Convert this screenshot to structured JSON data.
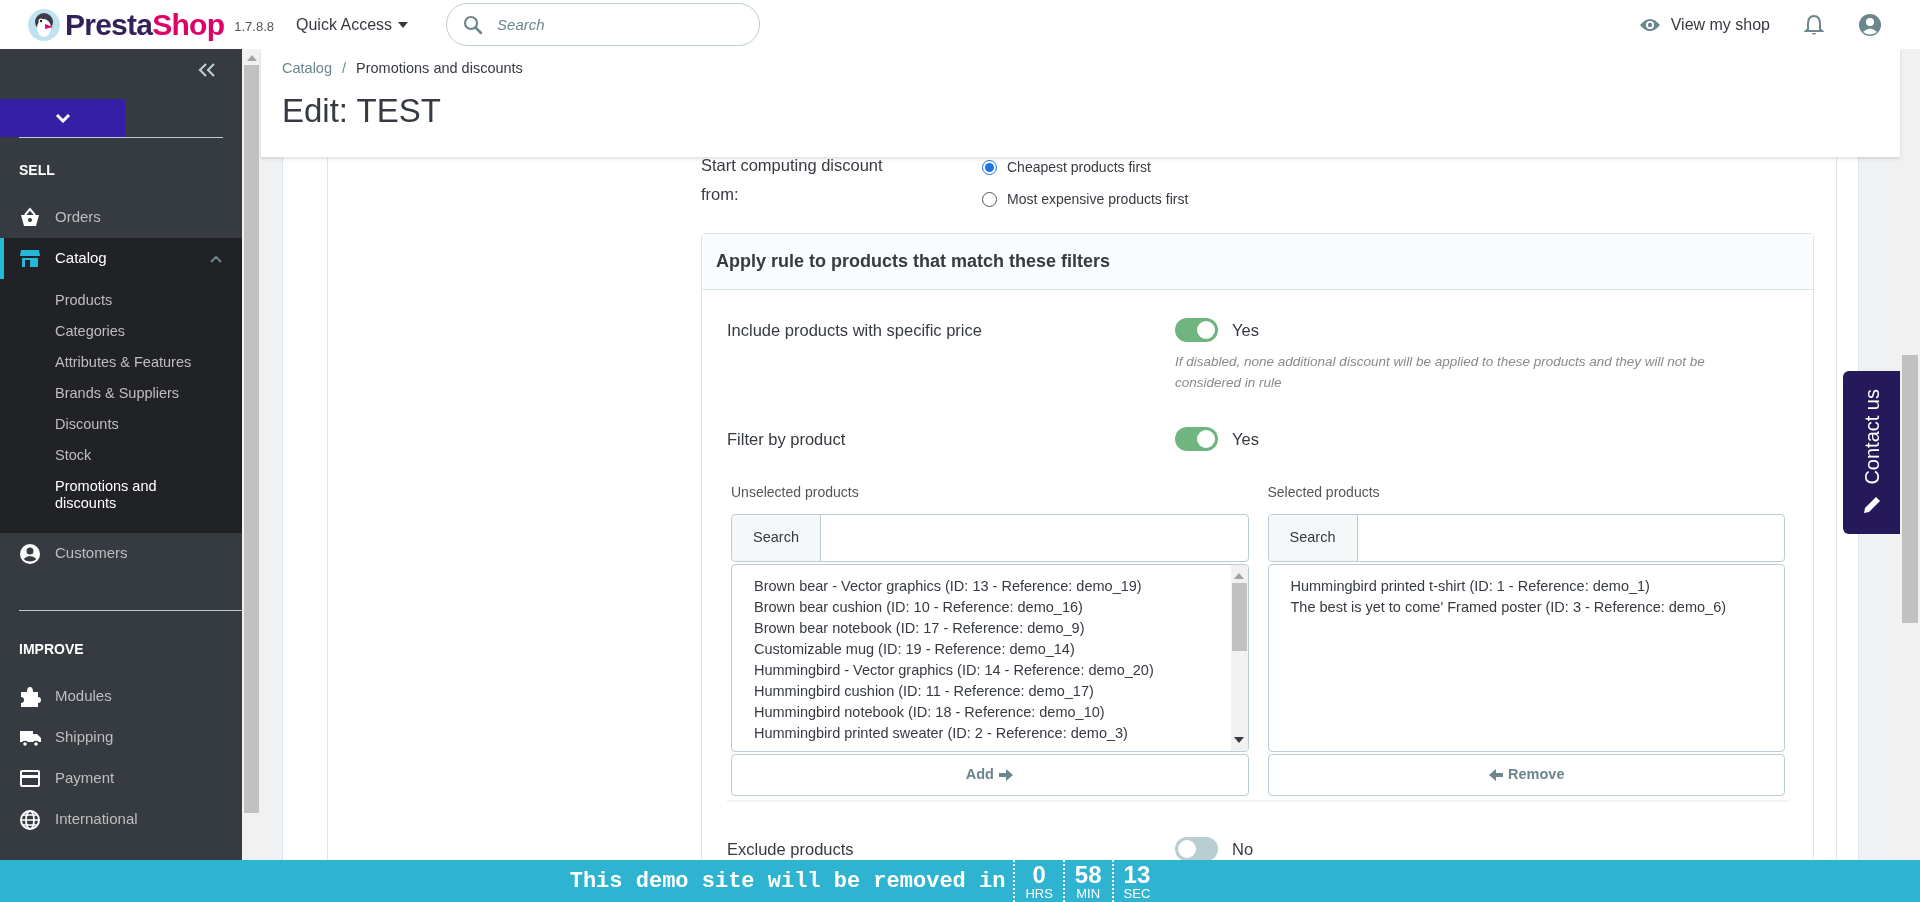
{
  "header": {
    "logo": {
      "parts": [
        "Presta",
        "Shop"
      ]
    },
    "version": "1.7.8.8",
    "quick_access": "Quick Access",
    "search": {
      "placeholder": "Search"
    },
    "view_shop": "View my shop"
  },
  "sidebar": {
    "sections": [
      {
        "title": "SELL",
        "items": [
          {
            "label": "Orders",
            "selected": false,
            "expanded": false
          },
          {
            "label": "Catalog",
            "selected": true,
            "expanded": true,
            "children": [
              {
                "label": "Products",
                "selected": false
              },
              {
                "label": "Categories",
                "selected": false
              },
              {
                "label": "Attributes & Features",
                "selected": false
              },
              {
                "label": "Brands & Suppliers",
                "selected": false
              },
              {
                "label": "Discounts",
                "selected": false
              },
              {
                "label": "Stock",
                "selected": false
              },
              {
                "label": "Promotions and discounts",
                "selected": true
              }
            ]
          },
          {
            "label": "Customers",
            "selected": false,
            "expanded": false
          }
        ]
      },
      {
        "title": "IMPROVE",
        "items": [
          {
            "label": "Modules",
            "selected": false,
            "expanded": false
          },
          {
            "label": "Shipping",
            "selected": false,
            "expanded": false
          },
          {
            "label": "Payment",
            "selected": false,
            "expanded": false
          },
          {
            "label": "International",
            "selected": false,
            "expanded": false
          }
        ]
      }
    ]
  },
  "breadcrumb": {
    "separator": "/",
    "links": [
      "Catalog",
      "Promotions and discounts"
    ]
  },
  "page_title": "Edit: TEST",
  "compute_from": {
    "label": "Start computing discount from:",
    "options": [
      {
        "label": "Cheapest products first",
        "selected": true
      },
      {
        "label": "Most expensive products first",
        "selected": false
      }
    ]
  },
  "filter_panel": {
    "title": "Apply rule to products that match these filters",
    "toggles": [
      {
        "label": "Include products with specific price",
        "on": true,
        "state_label": "Yes",
        "help": "If disabled, none additional discount will be applied to these products and they will not be considered in rule"
      },
      {
        "label": "Filter by product",
        "on": true,
        "state_label": "Yes"
      }
    ],
    "unselected": {
      "label": "Unselected products",
      "search_button": "Search",
      "items": [
        "Brown bear - Vector graphics (ID: 13 - Reference: demo_19)",
        "Brown bear cushion (ID: 10 - Reference: demo_16)",
        "Brown bear notebook (ID: 17 - Reference: demo_9)",
        "Customizable mug (ID: 19 - Reference: demo_14)",
        "Hummingbird - Vector graphics (ID: 14 - Reference: demo_20)",
        "Hummingbird cushion (ID: 11 - Reference: demo_17)",
        "Hummingbird notebook (ID: 18 - Reference: demo_10)",
        "Hummingbird printed sweater (ID: 2 - Reference: demo_3)"
      ],
      "button": "Add"
    },
    "selected": {
      "label": "Selected products",
      "search_button": "Search",
      "items": [
        "Hummingbird printed t-shirt (ID: 1 - Reference: demo_1)",
        "The best is yet to come' Framed poster (ID: 3 - Reference: demo_6)"
      ],
      "button": "Remove"
    },
    "exclude": {
      "label": "Exclude products",
      "on": false,
      "state_label": "No"
    }
  },
  "contact_tab": "Contact us",
  "demo_banner": {
    "text": "This demo site will be removed in",
    "timer": [
      {
        "value": "0",
        "unit": "HRS"
      },
      {
        "value": "58",
        "unit": "MIN"
      },
      {
        "value": "13",
        "unit": "SEC"
      }
    ]
  }
}
